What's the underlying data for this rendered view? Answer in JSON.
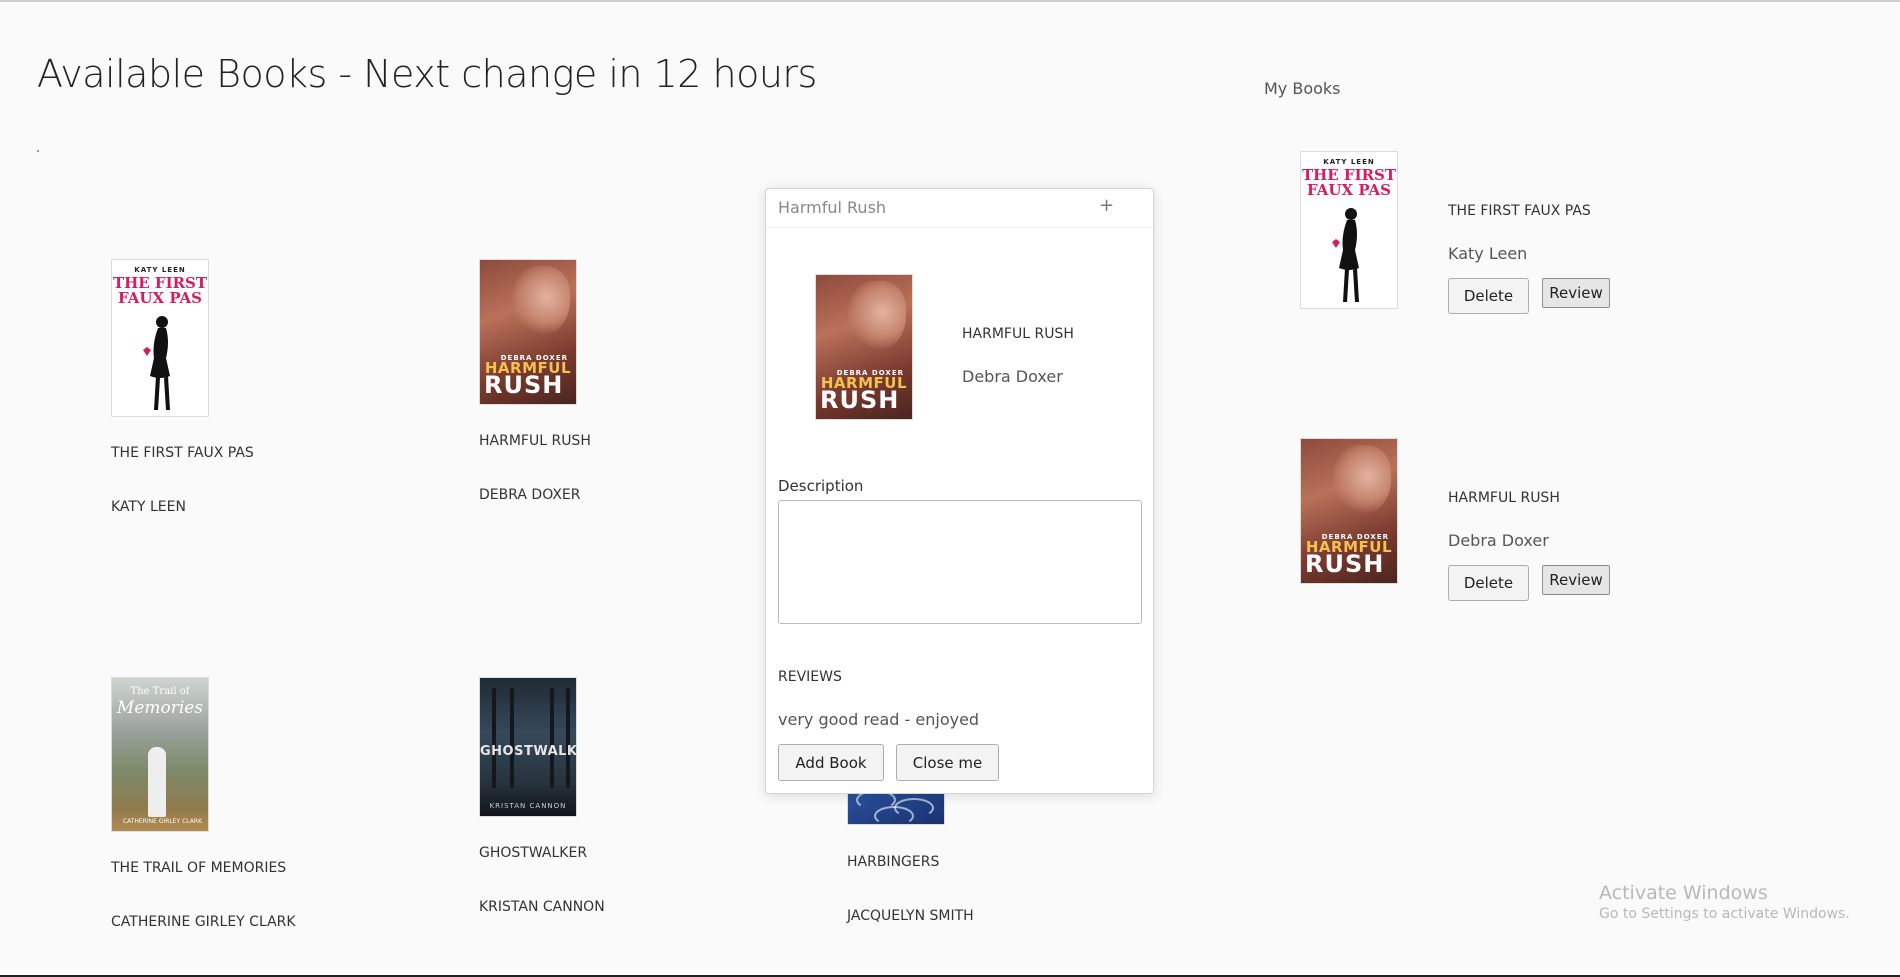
{
  "header": {
    "title": "Available Books - Next change in 12 hours"
  },
  "available_books": [
    {
      "title": "THE FIRST FAUX PAS",
      "author": "KATY LEEN",
      "cover": "first-faux-pas-cover"
    },
    {
      "title": "HARMFUL RUSH",
      "author": "DEBRA DOXER",
      "cover": "harmful-rush-cover"
    },
    {
      "title": "THE TRAIL OF MEMORIES",
      "author": "CATHERINE GIRLEY CLARK",
      "cover": "trail-of-memories-cover"
    },
    {
      "title": "GHOSTWALKER",
      "author": "KRISTAN CANNON",
      "cover": "ghostwalker-cover"
    },
    {
      "title": "HARBINGERS",
      "author": "JACQUELYN SMITH",
      "cover": "harbingers-cover"
    }
  ],
  "covers": {
    "faux": {
      "top": "KATY LEEN",
      "line1": "THE FIRST",
      "line2": "FAUX PAS"
    },
    "rush": {
      "author": "DEBRA DOXER",
      "word1": "HARMFUL",
      "word2": "RUSH"
    },
    "memories": {
      "line1": "The Trail of",
      "line2": "Memories",
      "author": "CATHERINE GIRLEY CLARK"
    },
    "ghost": {
      "title": "GHOSTWALKER",
      "author": "KRISTAN CANNON"
    }
  },
  "my_books": {
    "title": "My Books",
    "items": [
      {
        "title": "THE FIRST FAUX PAS",
        "author": "Katy Leen",
        "delete_label": "Delete",
        "review_label": "Review"
      },
      {
        "title": "HARMFUL RUSH",
        "author": "Debra Doxer",
        "delete_label": "Delete",
        "review_label": "Review"
      }
    ]
  },
  "modal": {
    "title": "Harmful Rush",
    "close_glyph": "+",
    "book_title": "HARMFUL RUSH",
    "book_author": "Debra Doxer",
    "description_label": "Description",
    "description_value": "",
    "reviews_label": "REVIEWS",
    "reviews": [
      "very good read - enjoyed"
    ],
    "add_label": "Add Book",
    "close_label": "Close me"
  },
  "watermark": {
    "line1": "Activate Windows",
    "line2": "Go to Settings to activate Windows."
  },
  "colors": {
    "background": "#fafafa",
    "faux_pink": "#d81b60",
    "rush_gold": "#f2c14e"
  }
}
